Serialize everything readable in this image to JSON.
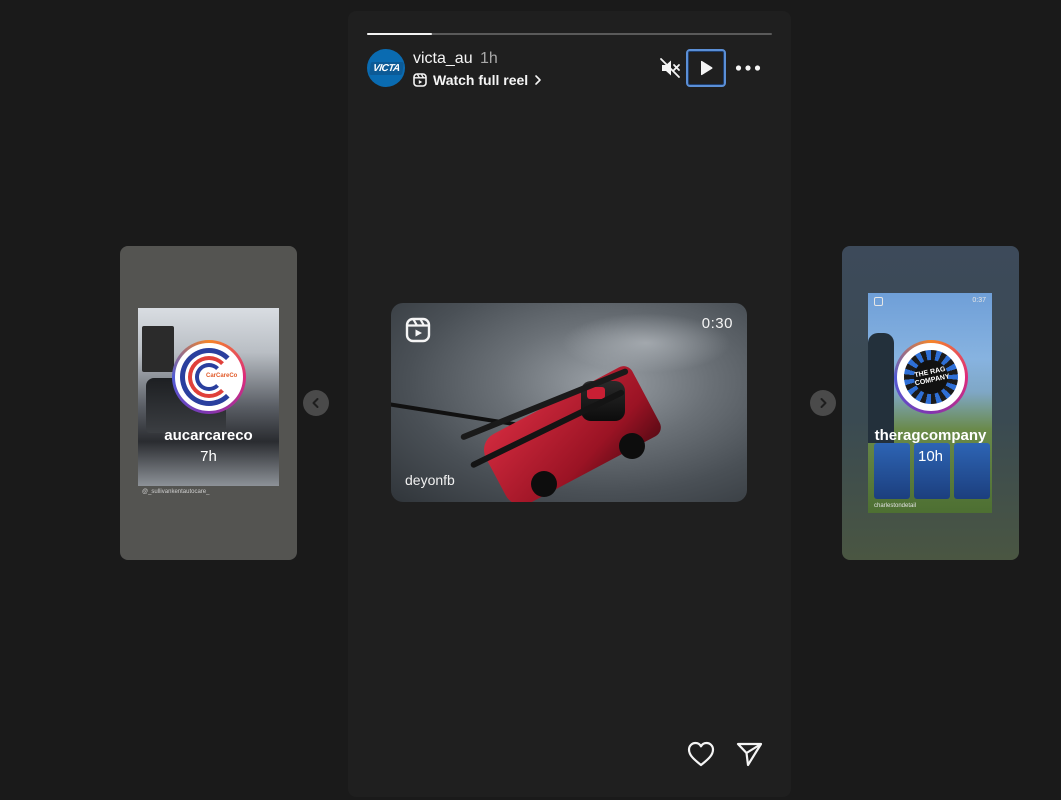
{
  "story": {
    "username": "victa_au",
    "time_ago": "1h",
    "avatar_text": "VICTA",
    "watch_full_reel": "Watch full reel",
    "progress_fraction": 0.16
  },
  "controls": {
    "mute_icon": "speaker-muted-icon",
    "play_icon": "play-icon",
    "more_icon": "more-horizontal-icon"
  },
  "reel_preview": {
    "duration": "0:30",
    "credit": "deyonfb",
    "reel_icon": "reels-icon"
  },
  "prev_story": {
    "username": "aucarcareco",
    "time_ago": "7h",
    "logo_text": "CarCareCo",
    "caption": "@_sullivankentautocare_"
  },
  "next_story": {
    "username": "theragcompany",
    "time_ago": "10h",
    "logo_text": "THE RAG COMPANY",
    "mini_time": "0:37",
    "caption": "charlestondetail"
  },
  "actions": {
    "like_icon": "heart-icon",
    "share_icon": "send-icon"
  },
  "colors": {
    "background": "#1a1a1a",
    "panel": "#1f1f1f",
    "story_ring_gradient": [
      "#f58529",
      "#dd2a7b",
      "#8134af",
      "#515bd4"
    ],
    "focus_outline": "#5b8fd6",
    "reel_red": "#d12a3e"
  }
}
